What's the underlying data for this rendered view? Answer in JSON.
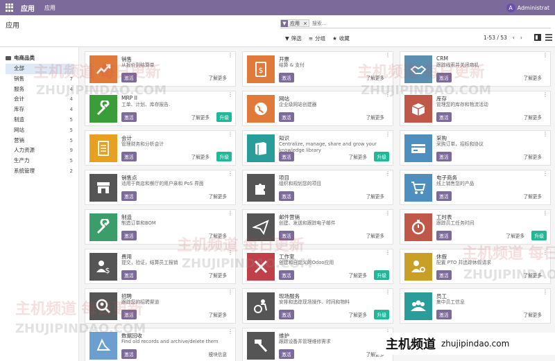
{
  "navbar": {
    "app_title": "应用",
    "menu": "应用",
    "user_initial": "A",
    "user": "Administrat"
  },
  "control": {
    "breadcrumb": "应用",
    "facet_label": "应用",
    "facet_close": "×",
    "search_placeholder": "搜索...",
    "filters": "筛选",
    "group": "分组",
    "favorites": "收藏",
    "pager": "1-53 / 53"
  },
  "sidebar": {
    "heading": "电商品类",
    "items": [
      {
        "label": "全部",
        "count": ""
      },
      {
        "label": "销售",
        "count": "7"
      },
      {
        "label": "服务",
        "count": "4"
      },
      {
        "label": "会计",
        "count": "4"
      },
      {
        "label": "库存",
        "count": "4"
      },
      {
        "label": "制造",
        "count": "5"
      },
      {
        "label": "网站",
        "count": "5"
      },
      {
        "label": "营销",
        "count": "5"
      },
      {
        "label": "人力资源",
        "count": "9"
      },
      {
        "label": "生产力",
        "count": "5"
      },
      {
        "label": "系统管理",
        "count": "2"
      }
    ]
  },
  "labels": {
    "activate": "激活",
    "learn_more": "了解更多",
    "upgrade": "升级",
    "module_info": "模块信息"
  },
  "apps": [
    {
      "name": "销售",
      "summary": "从报价到结算单",
      "color": "#e07a3a",
      "icon": "chart-icon",
      "upgrade": false
    },
    {
      "name": "开票",
      "summary": "结算 & 支付",
      "color": "#e07a3a",
      "icon": "invoice-icon",
      "upgrade": false
    },
    {
      "name": "CRM",
      "summary": "跟踪线索并关闭商机",
      "color": "#5a8fb0",
      "icon": "handshake-icon",
      "upgrade": false
    },
    {
      "name": "MRP II",
      "summary": "工单、计划、库存报告.",
      "color": "#3a9d3a",
      "icon": "wrench-icon",
      "upgrade": true
    },
    {
      "name": "网站",
      "summary": "企业级网站创建器",
      "color": "#e07a3a",
      "icon": "globe-icon",
      "upgrade": false
    },
    {
      "name": "库存",
      "summary": "管理您的库存和物流活动",
      "color": "#c0584a",
      "icon": "box-icon",
      "upgrade": false
    },
    {
      "name": "会计",
      "summary": "管理财务和分析会计",
      "color": "#e8a020",
      "icon": "document-icon",
      "upgrade": true
    },
    {
      "name": "知识",
      "summary": "Centralize, manage, share and grow your knowledge library",
      "color": "#2a9d9a",
      "icon": "book-icon",
      "upgrade": true
    },
    {
      "name": "采购",
      "summary": "采购订单，招标和协议",
      "color": "#4f8fc0",
      "icon": "card-icon",
      "upgrade": false
    },
    {
      "name": "销售点",
      "summary": "适用于商店和餐厅的用户亲和 PoS 界面",
      "color": "#555555",
      "icon": "store-icon",
      "upgrade": false
    },
    {
      "name": "项目",
      "summary": "组织和规划您的项目",
      "color": "#555555",
      "icon": "puzzle-icon",
      "upgrade": false
    },
    {
      "name": "电子商务",
      "summary": "线上销售您的产品",
      "color": "#4f8fc0",
      "icon": "cart-icon",
      "upgrade": false
    },
    {
      "name": "制造",
      "summary": "制造订单和BOM",
      "color": "#3a9d6a",
      "icon": "wrench-icon",
      "upgrade": false
    },
    {
      "name": "邮件营销",
      "summary": "创建、发送和跟踪电子邮件",
      "color": "#555555",
      "icon": "paper-plane-icon",
      "upgrade": false
    },
    {
      "name": "工时表",
      "summary": "跟踪员工任务时间",
      "color": "#c0584a",
      "icon": "stopwatch-icon",
      "upgrade": true
    },
    {
      "name": "费用",
      "summary": "提交，验证，结算员工报销",
      "color": "#555555",
      "icon": "expense-icon",
      "upgrade": false
    },
    {
      "name": "工作室",
      "summary": "创建和自定义的Odoo应用",
      "color": "#c0404a",
      "icon": "tools-icon",
      "upgrade": true
    },
    {
      "name": "休假",
      "summary": "配置 PTO 并追踪休假请求",
      "color": "#c8a028",
      "icon": "person-gear-icon",
      "upgrade": false
    },
    {
      "name": "招聘",
      "summary": "跟踪您的招聘渠道",
      "color": "#555555",
      "icon": "magnifier-icon",
      "upgrade": false
    },
    {
      "name": "现场服务",
      "summary": "安排和追踪现场操作、时间和物料",
      "color": "#555555",
      "icon": "gear-person-icon",
      "upgrade": true
    },
    {
      "name": "员工",
      "summary": "集中员工信息",
      "color": "#2a9d9a",
      "icon": "people-icon",
      "upgrade": false
    },
    {
      "name": "数据回收",
      "summary": "Find old records and archive/delete them",
      "color": "#6a9fd0",
      "icon": "recycle-icon",
      "upgrade": false,
      "module_info": true
    },
    {
      "name": "维护",
      "summary": "跟踪设备并管理维修需求",
      "color": "#555555",
      "icon": "hammer-icon",
      "upgrade": false
    }
  ],
  "watermarks": {
    "cn": "主机频道 每日更新",
    "en": "ZHUJIPINDAO.COM",
    "brand_cn": "主机频道",
    "brand_en": "zhujipindao.com"
  }
}
